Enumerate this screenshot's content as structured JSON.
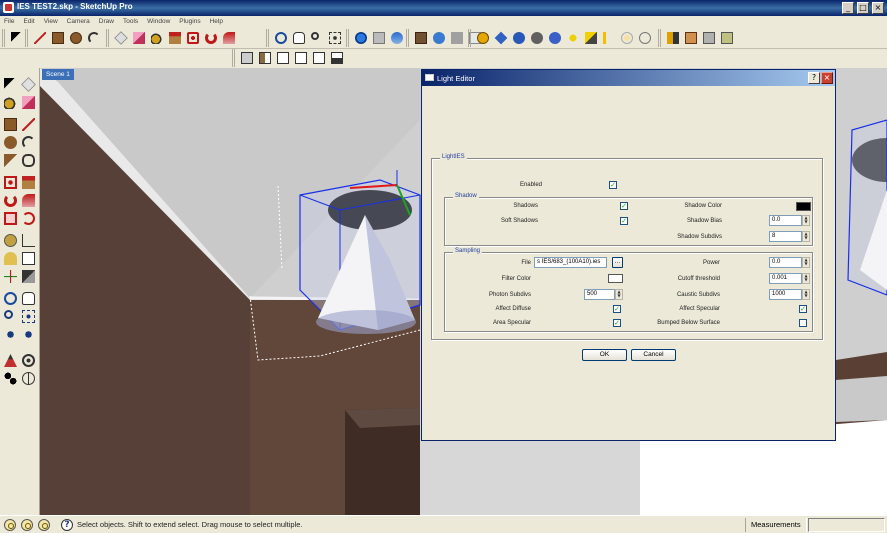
{
  "window": {
    "title": "IES TEST2.skp - SketchUp Pro",
    "controls": [
      "_",
      "□",
      "×"
    ]
  },
  "menubar": [
    "File",
    "Edit",
    "View",
    "Camera",
    "Draw",
    "Tools",
    "Window",
    "Plugins",
    "Help"
  ],
  "scene_tab": "Scene 1",
  "icons": {
    "toolbar1": [
      "select-icon",
      "line-icon",
      "rectangle-icon",
      "circle-icon",
      "arc-icon",
      "make-component-icon",
      "eraser-icon",
      "paint-bucket-icon",
      "push-pull-icon",
      "move-icon",
      "rotate-icon",
      "follow-me-icon",
      "orbit-icon",
      "pan-icon",
      "zoom-icon",
      "zoom-extents-icon",
      "previous-view-icon",
      "next-view-icon",
      "add-location-icon",
      "shadow-icon",
      "fog-icon",
      "warehouse-icon",
      "share-model-icon",
      "vray-material-icon",
      "vray-render-icon",
      "vray-rt-icon",
      "vray-help-icon",
      "omni-light-icon",
      "spot-light-icon",
      "ies-light-icon",
      "sphere-light-icon",
      "plane-light-icon",
      "infinite-plane-icon",
      "vray-proxy-icon",
      "vray-fur-icon"
    ],
    "toolbar2": [
      "iso-view-icon",
      "top-view-icon",
      "front-view-icon",
      "right-view-icon",
      "back-view-icon",
      "left-view-icon"
    ],
    "left_tools": [
      "select-icon",
      "make-component-icon",
      "paint-bucket-icon",
      "eraser-icon",
      "rectangle-icon",
      "line-icon",
      "circle-icon",
      "arc-icon",
      "polygon-icon",
      "freehand-icon",
      "move-icon",
      "push-pull-icon",
      "rotate-icon",
      "follow-me-icon",
      "scale-icon",
      "offset-icon",
      "tape-measure-icon",
      "dimension-icon",
      "protractor-icon",
      "text-icon",
      "axes-icon",
      "3d-text-icon",
      "orbit-icon",
      "pan-icon",
      "zoom-icon",
      "zoom-window-icon",
      "zoom-extents-icon",
      "previous-icon",
      "position-camera-icon",
      "look-around-icon",
      "walk-icon",
      "section-plane-icon"
    ]
  },
  "dialog": {
    "title": "Light Editor",
    "help_btn": "?",
    "close_btn": "×",
    "group_lightIES": "LightIES",
    "enabled_label": "Enabled",
    "enabled": "✓",
    "group_shadow": "Shadow",
    "shadows_label": "Shadows",
    "shadows": "✓",
    "soft_shadows_label": "Soft Shadows",
    "soft_shadows": "✓",
    "shadow_color_label": "Shadow Color",
    "shadow_color": "#000000",
    "shadow_bias_label": "Shadow Bias",
    "shadow_bias": "0.0",
    "shadow_subdivs_label": "Shadow Subdivs",
    "shadow_subdivs": "8",
    "group_sampling": "Sampling",
    "file_label": "File",
    "file_value": "s IES/683_(100A10).ies",
    "browse_btn": "...",
    "power_label": "Power",
    "power": "0.0",
    "filter_color_label": "Filter Color",
    "filter_color": "#ffffff",
    "cutoff_label": "Cutoff threshold",
    "cutoff": "0.001",
    "photon_subdivs_label": "Photon Subdivs",
    "photon_subdivs": "500",
    "caustic_subdivs_label": "Caustic Subdivs",
    "caustic_subdivs": "1000",
    "affect_diffuse_label": "Affect Diffuse",
    "affect_diffuse": "✓",
    "affect_specular_label": "Affect Specular",
    "affect_specular": "✓",
    "area_specular_label": "Area Specular",
    "area_specular": "✓",
    "bumped_label": "Bumped Below Surface",
    "bumped": "",
    "ok": "OK",
    "cancel": "Cancel"
  },
  "status": {
    "text": "Select objects. Shift to extend select. Drag mouse to select multiple.",
    "help": "?",
    "measurements_label": "Measurements",
    "measurements_value": ""
  }
}
